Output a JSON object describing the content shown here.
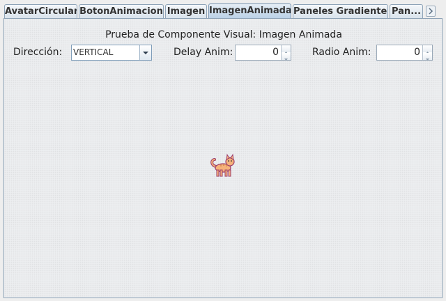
{
  "tabs": [
    {
      "label": "AvatarCircular"
    },
    {
      "label": "BotonAnimacion"
    },
    {
      "label": "Imagen"
    },
    {
      "label": "ImagenAnimada"
    },
    {
      "label": "Paneles Gradientes"
    },
    {
      "label": "Pan..."
    }
  ],
  "selected_tab": "ImagenAnimada",
  "panel": {
    "title": "Prueba de Componente Visual: Imagen Animada",
    "direction_label": "Dirección:",
    "direction_value": "VERTICAL",
    "delay_label": "Delay Anim:",
    "delay_value": "0",
    "radius_label": "Radio Anim:",
    "radius_value": "0"
  },
  "icons": {
    "animated_image": "cat-icon",
    "combo_arrow": "chevron-down-icon",
    "spinner_up": "triangle-up-icon",
    "spinner_down": "triangle-down-icon",
    "tab_scroll_forward": "chevron-right-icon"
  },
  "colors": {
    "selected_tab": "#b8cfe5",
    "border": "#8ea3b7",
    "cat_fill": "#f5b27a",
    "cat_outline": "#9b3b6a"
  }
}
